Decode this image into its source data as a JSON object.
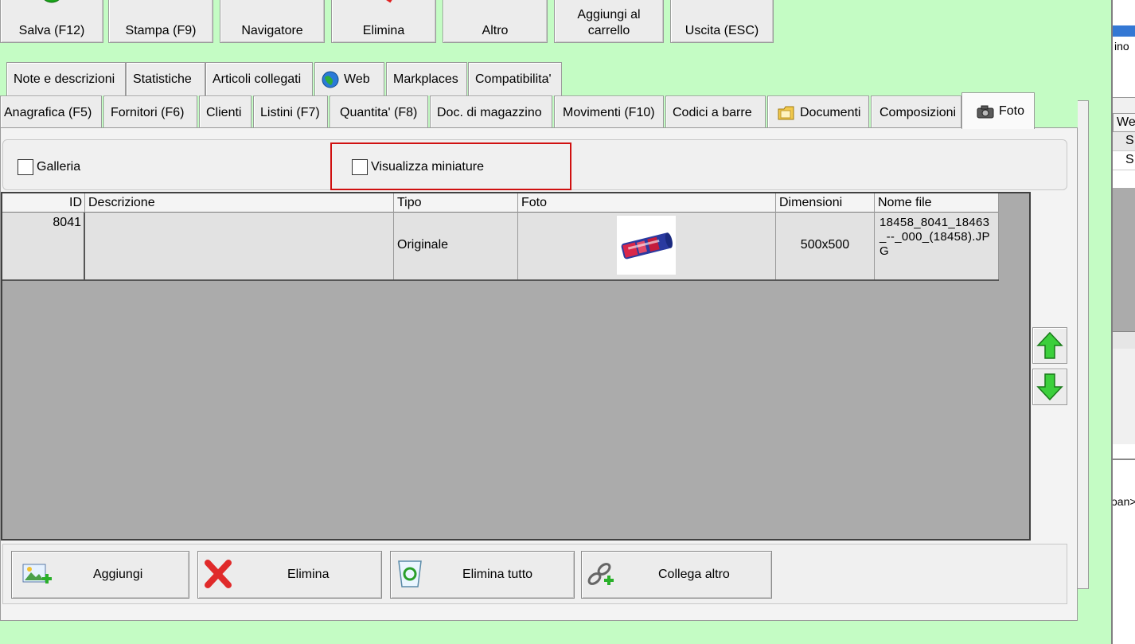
{
  "toolbar": {
    "buttons": [
      {
        "label": "Salva (F12)"
      },
      {
        "label": "Stampa (F9)"
      },
      {
        "label": "Navigatore"
      },
      {
        "label": "Elimina"
      },
      {
        "label": "Altro"
      },
      {
        "label": "Aggiungi al\ncarrello"
      },
      {
        "label": "Uscita (ESC)"
      }
    ]
  },
  "tabs_row1": [
    {
      "label": "Note e descrizioni"
    },
    {
      "label": "Statistiche"
    },
    {
      "label": "Articoli collegati"
    },
    {
      "label": "Web",
      "icon": "globe-icon"
    },
    {
      "label": "Markplaces"
    },
    {
      "label": "Compatibilita'"
    }
  ],
  "tabs_row2": [
    {
      "label": "Anagrafica (F5)"
    },
    {
      "label": "Fornitori (F6)"
    },
    {
      "label": "Clienti"
    },
    {
      "label": "Listini (F7)"
    },
    {
      "label": "Quantita' (F8)"
    },
    {
      "label": "Doc. di magazzino"
    },
    {
      "label": "Movimenti (F10)"
    },
    {
      "label": "Codici a barre"
    },
    {
      "label": "Documenti",
      "icon": "folder-icon"
    },
    {
      "label": "Composizioni"
    },
    {
      "label": "Foto",
      "icon": "camera-icon",
      "active": true
    }
  ],
  "options": {
    "galleria": {
      "label": "Galleria",
      "checked": false
    },
    "miniature": {
      "label": "Visualizza miniature",
      "checked": false
    }
  },
  "grid": {
    "columns": [
      "ID",
      "Descrizione",
      "Tipo",
      "Foto",
      "Dimensioni",
      "Nome file"
    ],
    "rows": [
      {
        "id": "8041",
        "descrizione": "",
        "tipo": "Originale",
        "foto": "product-thumbnail",
        "dimensioni": "500x500",
        "nome_file": "18458_8041_18463_--_000_(18458).JPG"
      }
    ]
  },
  "actions": {
    "aggiungi": "Aggiungi",
    "elimina": "Elimina",
    "elimina_tutto": "Elimina tutto",
    "collega_altro": "Collega altro"
  },
  "right_window": {
    "text_1": "ino",
    "text_2": "We",
    "text_3": "S",
    "text_4": "S",
    "text_5": "oan>"
  },
  "colors": {
    "background": "#c4fcc4",
    "highlight_frame": "#d01010",
    "grid_empty": "#ababab"
  }
}
